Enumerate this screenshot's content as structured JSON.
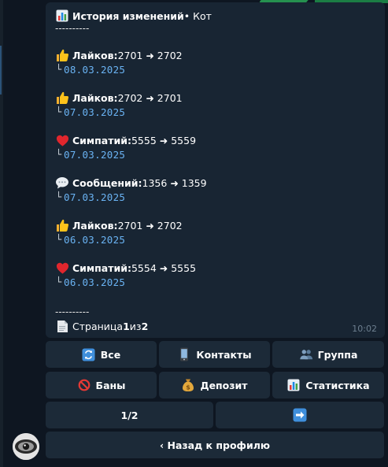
{
  "colors": {
    "background": "#0e1621",
    "bubble": "#182533",
    "keyboard_button": "#1c2a38",
    "date_link": "#6ab3f3",
    "time": "#6d7f8f"
  },
  "message": {
    "title_bold": "История изменений",
    "title_suffix": " • Кот",
    "separator": "----------",
    "entries": [
      {
        "icon": "thumbs-up-icon",
        "label": "Лайков:",
        "change": " 2701 ➜ 2702",
        "date": "08.03.2025"
      },
      {
        "icon": "thumbs-up-icon",
        "label": "Лайков:",
        "change": " 2702 ➜ 2701",
        "date": "07.03.2025"
      },
      {
        "icon": "heart-icon",
        "label": "Симпатий:",
        "change": " 5555 ➜ 5559",
        "date": "07.03.2025"
      },
      {
        "icon": "speech-bubble-icon",
        "label": "Сообщений:",
        "change": " 1356 ➜ 1359",
        "date": "07.03.2025"
      },
      {
        "icon": "thumbs-up-icon",
        "label": "Лайков:",
        "change": " 2701 ➜ 2702",
        "date": "06.03.2025"
      },
      {
        "icon": "heart-icon",
        "label": "Симпатий:",
        "change": " 5554 ➜ 5555",
        "date": "06.03.2025"
      }
    ],
    "date_prefix": "└",
    "footer_separator": "----------",
    "page_prefix": "Страница ",
    "page_current": "1",
    "page_middle": " из ",
    "page_total": "2",
    "time": "10:02"
  },
  "keyboard": {
    "all": "Все",
    "contacts": "Контакты",
    "group": "Группа",
    "bans": "Баны",
    "deposit": "Депозит",
    "statistics": "Статистика",
    "page_indicator": "1/2",
    "next_icon": "right-arrow-icon",
    "back": "‹ Назад к профилю"
  }
}
